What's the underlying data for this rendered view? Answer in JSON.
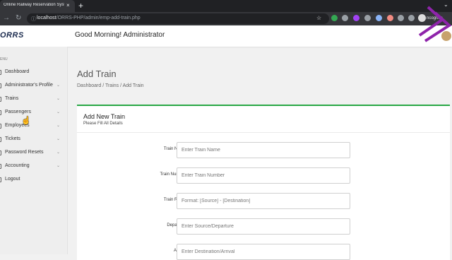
{
  "browser": {
    "tab_title": "Online Railway Reservation Syste",
    "tab_close": "×",
    "new_tab": "+",
    "url_host": "localhost",
    "url_path": "/ORRS-PHP/admin/emp-add-train.php",
    "profile_label": "ncognito"
  },
  "app": {
    "logo": "ORRS",
    "greeting": "Good Morning! Administrator"
  },
  "sidebar": {
    "menu_label": "ENU",
    "items": [
      {
        "label": "Dashboard",
        "has_children": false
      },
      {
        "label": "Administrator's Profile",
        "has_children": true
      },
      {
        "label": "Trains",
        "has_children": true
      },
      {
        "label": "Passengers",
        "has_children": true
      },
      {
        "label": "Employees",
        "has_children": true
      },
      {
        "label": "Tickets",
        "has_children": true
      },
      {
        "label": "Password Resets",
        "has_children": true
      },
      {
        "label": "Accounting",
        "has_children": true
      },
      {
        "label": "Logout",
        "has_children": false
      }
    ],
    "chevron": "⌄"
  },
  "main": {
    "page_title": "Add Train",
    "breadcrumb": "Dashboard / Trains / Add Train",
    "card": {
      "title": "Add New Train",
      "subtitle": "Please Fill All Details"
    },
    "fields": [
      {
        "label": "Train Name",
        "placeholder": "Enter Train Name"
      },
      {
        "label": "Train Number",
        "placeholder": "Enter Train Number"
      },
      {
        "label": "Train Route",
        "placeholder": "Format: [Source] - [Destination]"
      },
      {
        "label": "Departure",
        "placeholder": "Enter Source/Departure"
      },
      {
        "label": "Arrival",
        "placeholder": "Enter Destination/Arrival"
      }
    ]
  },
  "colors": {
    "card_accent": "#28a745",
    "deco": "#8e24aa",
    "browser_bg": "#202124"
  }
}
